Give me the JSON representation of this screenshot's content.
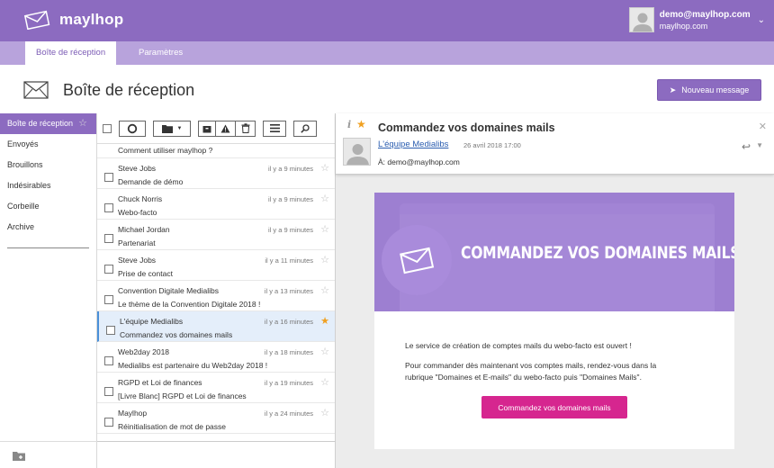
{
  "header": {
    "app_name": "maylhop",
    "user_email": "demo@maylhop.com",
    "user_domain": "maylhop.com"
  },
  "tabs": [
    {
      "label": "Boîte de réception",
      "active": true
    },
    {
      "label": "Paramètres",
      "active": false
    }
  ],
  "page": {
    "title": "Boîte de réception",
    "new_message_label": "Nouveau message"
  },
  "sidebar": {
    "items": [
      {
        "label": "Boîte de réception",
        "active": true
      },
      {
        "label": "Envoyés"
      },
      {
        "label": "Brouillons"
      },
      {
        "label": "Indésirables"
      },
      {
        "label": "Corbeille"
      },
      {
        "label": "Archive"
      }
    ]
  },
  "messages": [
    {
      "from": "",
      "subject": "Comment utiliser maylhop ?",
      "time": "",
      "starred": false
    },
    {
      "from": "Steve Jobs",
      "subject": "Demande de démo",
      "time": "il y a 9 minutes",
      "starred": false
    },
    {
      "from": "Chuck Norris",
      "subject": "Webo-facto",
      "time": "il y a 9 minutes",
      "starred": false
    },
    {
      "from": "Michael Jordan",
      "subject": "Partenariat",
      "time": "il y a 9 minutes",
      "starred": false
    },
    {
      "from": "Steve Jobs",
      "subject": "Prise de contact",
      "time": "il y a 11 minutes",
      "starred": false
    },
    {
      "from": "Convention Digitale Medialibs",
      "subject": "Le thème de la Convention Digitale 2018 !",
      "time": "il y a 13 minutes",
      "starred": false
    },
    {
      "from": "L'équipe Medialibs",
      "subject": "Commandez vos domaines mails",
      "time": "il y a 16 minutes",
      "starred": true,
      "selected": true
    },
    {
      "from": "Web2day 2018",
      "subject": "Medialibs est partenaire du Web2day 2018 !",
      "time": "il y a 18 minutes",
      "starred": false
    },
    {
      "from": "RGPD et Loi de finances",
      "subject": "[Livre Blanc] RGPD et Loi de finances",
      "time": "il y a 19 minutes",
      "starred": false
    },
    {
      "from": "Maylhop",
      "subject": "Réinitialisation de mot de passe",
      "time": "il y a 24 minutes",
      "starred": false
    }
  ],
  "reader": {
    "subject": "Commandez vos domaines mails",
    "sender": "L'équipe Medialibs",
    "date": "26 avril 2018 17:00",
    "to": "À: demo@maylhop.com",
    "banner_title": "COMMANDEZ VOS DOMAINES MAILS",
    "paragraph1": "Le service de création de comptes mails du webo-facto est ouvert !",
    "paragraph2_line1": "Pour commander dès maintenant vos comptes mails, rendez-vous dans la",
    "paragraph2_line2": "rubrique \"Domaines et E-mails\" du webo-facto puis \"Domaines Mails\".",
    "cta_label": "Commandez vos domaines mails"
  },
  "colors": {
    "brand": "#8c6bc0",
    "tab_bar": "#b8a3dc",
    "cta": "#d6268f",
    "star_active": "#f0a020",
    "link": "#2a5db0"
  }
}
